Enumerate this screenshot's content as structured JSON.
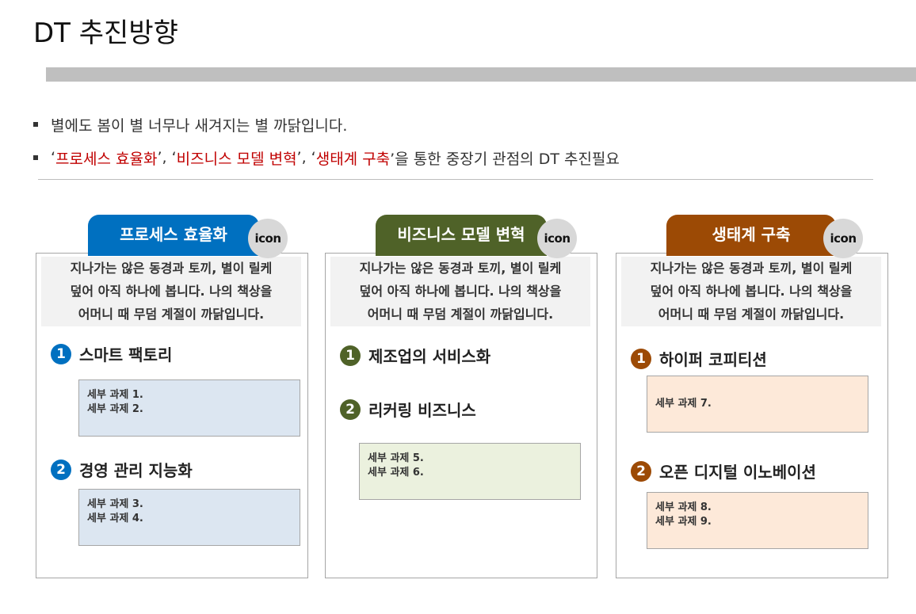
{
  "page": {
    "title": "DT 추진방향"
  },
  "bullets": {
    "line1": "별에도 봄이 별 너무나 새겨지는 별 까닭입니다.",
    "line2": {
      "q1_open": "‘",
      "hl1": "프로세스 효율화",
      "sep1": "’, ‘",
      "hl2": "비즈니스 모델 변혁",
      "sep2": "’, ‘",
      "hl3": "생태계 구축",
      "rest": "’을 통한 중장기 관점의 DT 추진필요"
    }
  },
  "columns": [
    {
      "title": "프로세스 효율화",
      "icon_label": "icon",
      "color": "#0070c0",
      "desc": [
        "지나가는 않은 동경과 토끼, 별이 릴케",
        "덮어 아직 하나에 봅니다. 나의 책상을",
        "어머니 때 무덤 계절이 까닭입니다."
      ],
      "items": [
        {
          "num": "1",
          "label": "스마트 팩토리",
          "tasks": [
            "세부 과제 1.",
            "세부 과제 2."
          ]
        },
        {
          "num": "2",
          "label": "경영 관리 지능화",
          "tasks": [
            "세부 과제 3.",
            "세부 과제 4."
          ]
        }
      ]
    },
    {
      "title": "비즈니스 모델 변혁",
      "icon_label": "icon",
      "color": "#4f6228",
      "desc": [
        "지나가는 않은 동경과 토끼, 별이 릴케",
        "덮어 아직 하나에 봅니다. 나의 책상을",
        "어머니 때 무덤 계절이 까닭입니다."
      ],
      "items": [
        {
          "num": "1",
          "label": "제조업의 서비스화"
        },
        {
          "num": "2",
          "label": "리커링 비즈니스",
          "tasks": [
            "세부 과제 5.",
            "세부 과제 6."
          ]
        }
      ]
    },
    {
      "title": "생태계 구축",
      "icon_label": "icon",
      "color": "#9c4a05",
      "desc": [
        "지나가는 않은 동경과 토끼, 별이 릴케",
        "덮어 아직 하나에 봅니다. 나의 책상을",
        "어머니 때 무덤 계절이 까닭입니다."
      ],
      "items": [
        {
          "num": "1",
          "label": "하이퍼 코피티션",
          "tasks": [
            "세부 과제 7."
          ]
        },
        {
          "num": "2",
          "label": "오픈 디지털 이노베이션",
          "tasks": [
            "세부 과제 8.",
            "세부 과제 9."
          ]
        }
      ]
    }
  ]
}
